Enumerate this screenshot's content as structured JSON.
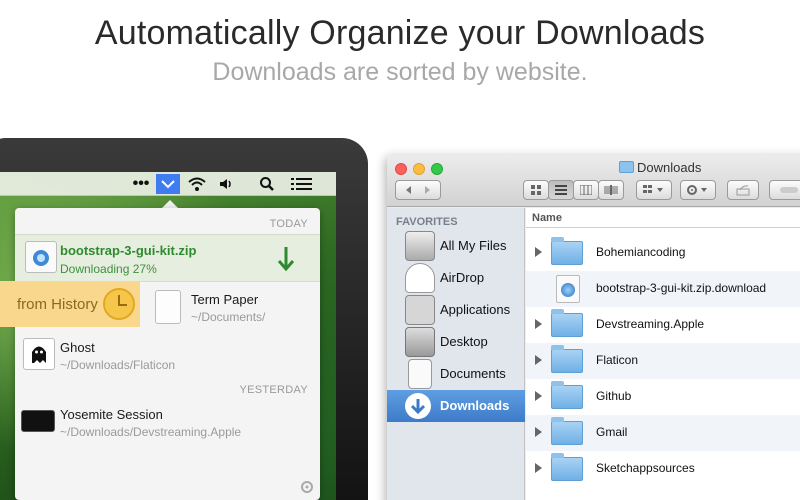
{
  "headline": "Automatically Organize your Downloads",
  "subheadline": "Downloads are sorted by website.",
  "menubar": {
    "icons": [
      "ellipsis-icon",
      "downloads-chevron-icon",
      "wifi-icon",
      "volume-icon",
      "search-icon",
      "list-icon"
    ],
    "active_color": "#3f7cf0"
  },
  "popup": {
    "today_label": "TODAY",
    "yesterday_label": "YESTERDAY",
    "active_download": {
      "name": "bootstrap-3-gui-kit.zip",
      "status": "Downloading 27%",
      "progress": 27
    },
    "history_tag": "from History",
    "items": [
      {
        "title": "Term Paper",
        "path": "~/Documents/"
      },
      {
        "title": "Ghost",
        "path": "~/Downloads/Flaticon"
      },
      {
        "title": "Yosemite Session",
        "path": "~/Downloads/Devstreaming.Apple"
      }
    ]
  },
  "finder": {
    "title": "Downloads",
    "sidebar_heading": "FAVORITES",
    "sidebar": [
      {
        "label": "All My Files",
        "icon": "all-my-files-icon"
      },
      {
        "label": "AirDrop",
        "icon": "airdrop-icon"
      },
      {
        "label": "Applications",
        "icon": "applications-icon"
      },
      {
        "label": "Desktop",
        "icon": "desktop-icon"
      },
      {
        "label": "Documents",
        "icon": "documents-icon"
      },
      {
        "label": "Downloads",
        "icon": "downloads-icon",
        "selected": true
      }
    ],
    "column_header": "Name",
    "files": [
      {
        "name": "Bohemiancoding",
        "kind": "folder"
      },
      {
        "name": "bootstrap-3-gui-kit.zip.download",
        "kind": "download"
      },
      {
        "name": "Devstreaming.Apple",
        "kind": "folder"
      },
      {
        "name": "Flaticon",
        "kind": "folder"
      },
      {
        "name": "Github",
        "kind": "folder"
      },
      {
        "name": "Gmail",
        "kind": "folder"
      },
      {
        "name": "Sketchappsources",
        "kind": "folder"
      }
    ]
  },
  "colors": {
    "accent_blue": "#3f7cf0",
    "download_green": "#2f8a2f",
    "history_yellow": "#f9d88e"
  }
}
